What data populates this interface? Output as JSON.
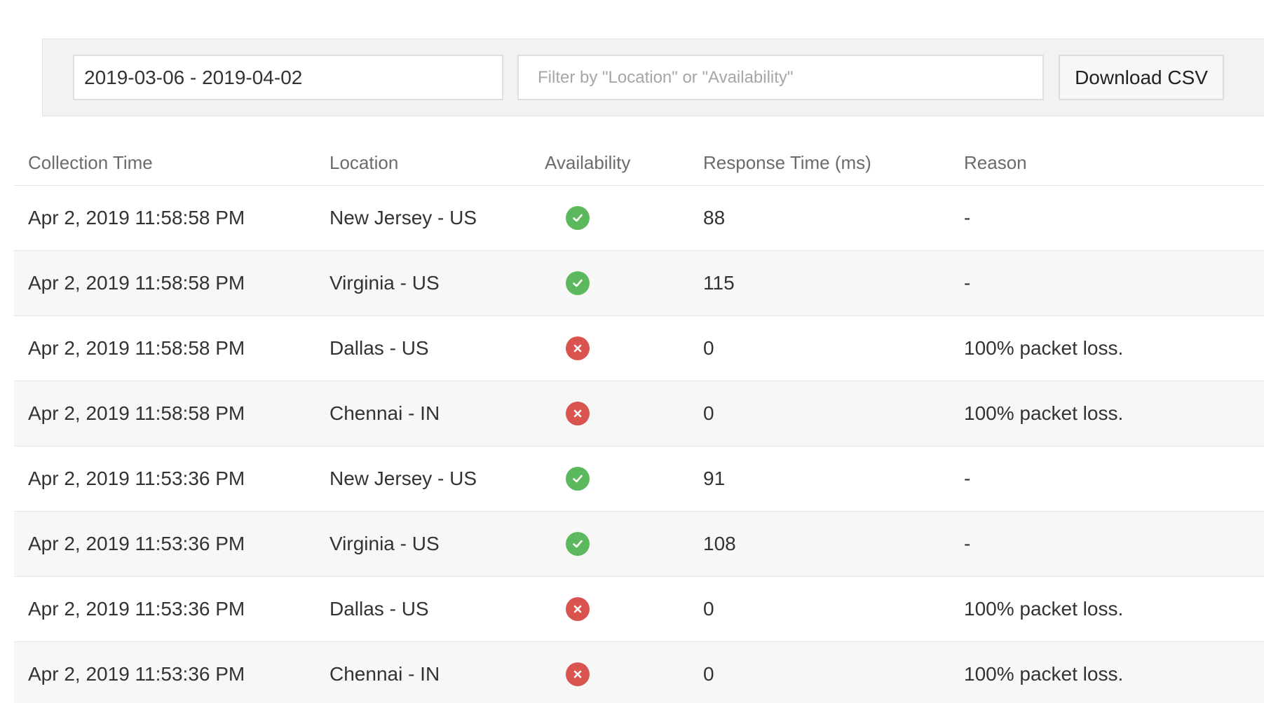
{
  "toolbar": {
    "date_range": "2019-03-06 - 2019-04-02",
    "filter_placeholder": "Filter by \"Location\" or \"Availability\"",
    "filter_value": "",
    "download_label": "Download CSV"
  },
  "table": {
    "headers": {
      "collection_time": "Collection Time",
      "location": "Location",
      "availability": "Availability",
      "response_time": "Response Time (ms)",
      "reason": "Reason"
    },
    "rows": [
      {
        "time": "Apr 2, 2019 11:58:58 PM",
        "location": "New Jersey - US",
        "availability": "up",
        "availability_icon": "check-circle-icon",
        "response": "88",
        "reason": "-"
      },
      {
        "time": "Apr 2, 2019 11:58:58 PM",
        "location": "Virginia - US",
        "availability": "up",
        "availability_icon": "check-circle-icon",
        "response": "115",
        "reason": "-"
      },
      {
        "time": "Apr 2, 2019 11:58:58 PM",
        "location": "Dallas - US",
        "availability": "down",
        "availability_icon": "x-circle-icon",
        "response": "0",
        "reason": "100% packet loss."
      },
      {
        "time": "Apr 2, 2019 11:58:58 PM",
        "location": "Chennai - IN",
        "availability": "down",
        "availability_icon": "x-circle-icon",
        "response": "0",
        "reason": "100% packet loss."
      },
      {
        "time": "Apr 2, 2019 11:53:36 PM",
        "location": "New Jersey - US",
        "availability": "up",
        "availability_icon": "check-circle-icon",
        "response": "91",
        "reason": "-"
      },
      {
        "time": "Apr 2, 2019 11:53:36 PM",
        "location": "Virginia - US",
        "availability": "up",
        "availability_icon": "check-circle-icon",
        "response": "108",
        "reason": "-"
      },
      {
        "time": "Apr 2, 2019 11:53:36 PM",
        "location": "Dallas - US",
        "availability": "down",
        "availability_icon": "x-circle-icon",
        "response": "0",
        "reason": "100% packet loss."
      },
      {
        "time": "Apr 2, 2019 11:53:36 PM",
        "location": "Chennai - IN",
        "availability": "down",
        "availability_icon": "x-circle-icon",
        "response": "0",
        "reason": "100% packet loss."
      }
    ]
  },
  "colors": {
    "up": "#5cb85c",
    "down": "#d9534f"
  }
}
